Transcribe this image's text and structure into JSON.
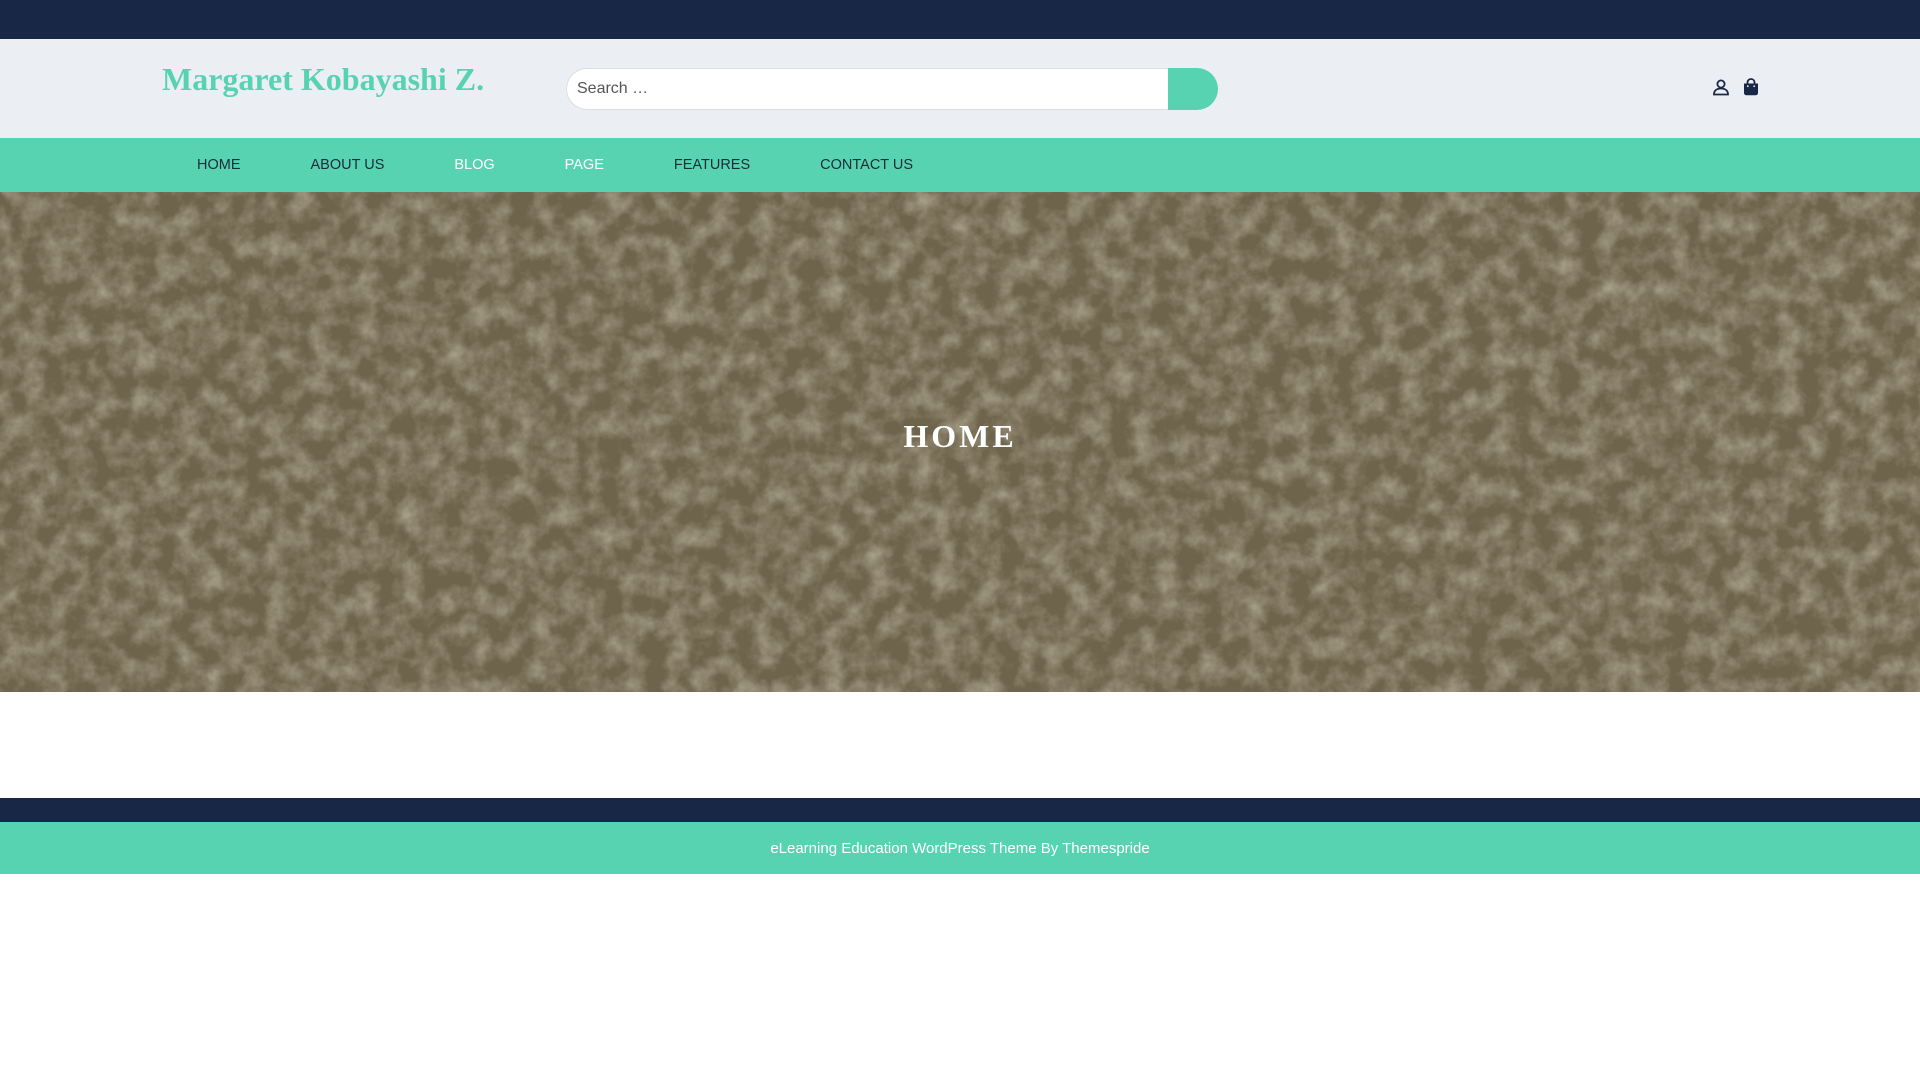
{
  "site": {
    "title": "Margaret Kobayashi Z."
  },
  "search": {
    "placeholder": "Search …",
    "value": ""
  },
  "header_icons": [
    "user-icon",
    "shopping-bag-icon"
  ],
  "nav": {
    "items": [
      {
        "label": "HOME"
      },
      {
        "label": "ABOUT US"
      },
      {
        "label": "BLOG"
      },
      {
        "label": "PAGE"
      },
      {
        "label": "FEATURES"
      },
      {
        "label": "CONTACT US"
      }
    ]
  },
  "hero": {
    "title": "HOME"
  },
  "footer": {
    "credit": "eLearning Education WordPress Theme By Themespride"
  },
  "colors": {
    "top_bar": "#182746",
    "header_bg": "#ebeff3",
    "accent": "#58d3b1",
    "hero_bg": "#6e634b",
    "nav_text_dark": "#1b2b3a",
    "nav_text_light": "#ffffff"
  }
}
